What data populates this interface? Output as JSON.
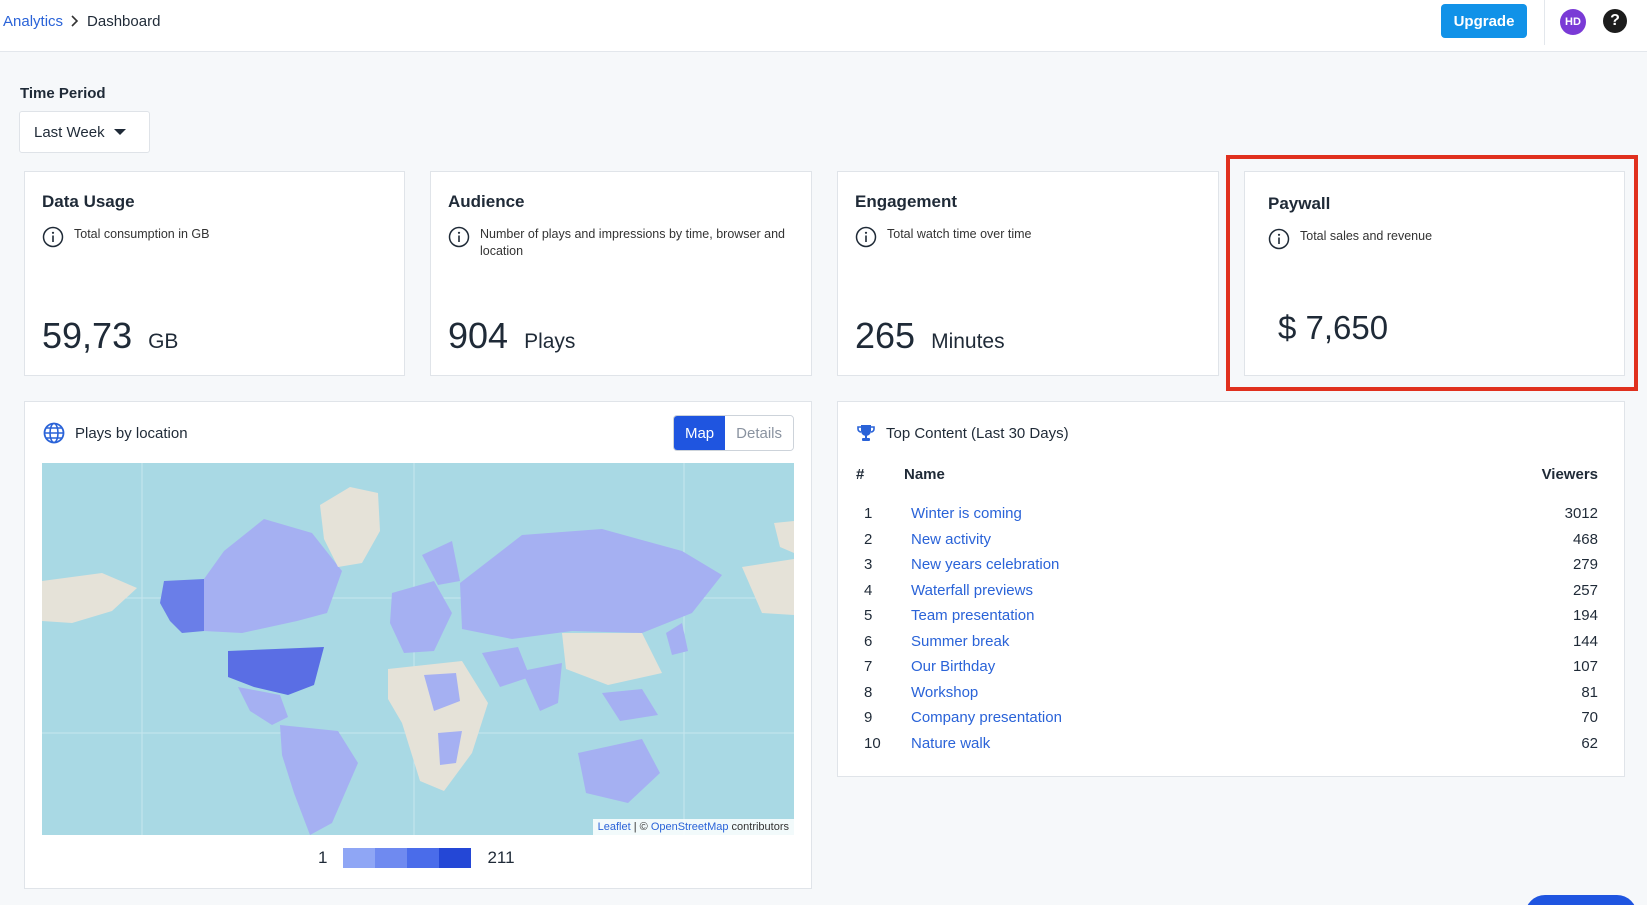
{
  "breadcrumb": {
    "parent": "Analytics",
    "current": "Dashboard"
  },
  "header": {
    "upgrade_label": "Upgrade",
    "avatar_initials": "HD",
    "help_glyph": "?"
  },
  "time_period": {
    "label": "Time Period",
    "selected": "Last Week"
  },
  "cards": {
    "data_usage": {
      "title": "Data Usage",
      "desc": "Total consumption in GB",
      "value": "59,73",
      "unit": "GB"
    },
    "audience": {
      "title": "Audience",
      "desc": "Number of plays and impressions by time, browser and location",
      "value": "904",
      "unit": "Plays"
    },
    "engagement": {
      "title": "Engagement",
      "desc": "Total watch time over time",
      "value": "265",
      "unit": "Minutes"
    },
    "paywall": {
      "title": "Paywall",
      "desc": "Total sales and revenue",
      "value": "$ 7,650"
    }
  },
  "map_panel": {
    "title": "Plays by location",
    "tabs": {
      "map": "Map",
      "details": "Details"
    },
    "attribution": {
      "leaflet": "Leaflet",
      "sep": " | © ",
      "osm": "OpenStreetMap",
      "tail": " contributors"
    },
    "legend": {
      "min": "1",
      "max": "211"
    }
  },
  "top_content": {
    "title": "Top Content (Last 30 Days)",
    "columns": {
      "rank": "#",
      "name": "Name",
      "viewers": "Viewers"
    },
    "rows": [
      {
        "rank": "1",
        "name": "Winter is coming",
        "viewers": "3012"
      },
      {
        "rank": "2",
        "name": "New activity",
        "viewers": "468"
      },
      {
        "rank": "3",
        "name": "New years celebration",
        "viewers": "279"
      },
      {
        "rank": "4",
        "name": "Waterfall previews",
        "viewers": "257"
      },
      {
        "rank": "5",
        "name": "Team presentation",
        "viewers": "194"
      },
      {
        "rank": "6",
        "name": "Summer break",
        "viewers": "144"
      },
      {
        "rank": "7",
        "name": "Our Birthday",
        "viewers": "107"
      },
      {
        "rank": "8",
        "name": "Workshop",
        "viewers": "81"
      },
      {
        "rank": "9",
        "name": "Company presentation",
        "viewers": "70"
      },
      {
        "rank": "10",
        "name": "Nature walk",
        "viewers": "62"
      }
    ]
  },
  "colors": {
    "accent": "#1f55e0",
    "upgrade": "#1192e8",
    "highlight": "#e0301e",
    "legend_scale": [
      "#8fa6f5",
      "#6f8af0",
      "#4a6cea",
      "#2447d6"
    ]
  },
  "icons": {
    "info": "info-icon",
    "globe": "globe-icon",
    "trophy": "trophy-icon",
    "caret": "caret-down-icon"
  }
}
